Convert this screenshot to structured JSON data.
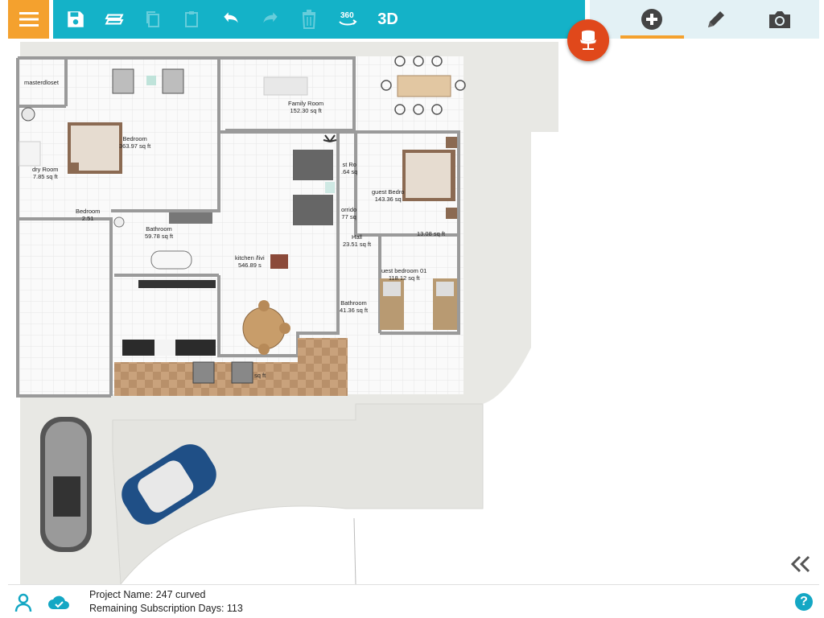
{
  "toolbar": {
    "menu_icon": "hamburger-icon",
    "buttons": [
      {
        "name": "save",
        "icon": "save-icon"
      },
      {
        "name": "layers",
        "icon": "layers-icon"
      },
      {
        "name": "copy",
        "icon": "copy-icon",
        "disabled": true
      },
      {
        "name": "paste",
        "icon": "paste-icon",
        "disabled": true
      },
      {
        "name": "undo",
        "icon": "undo-icon"
      },
      {
        "name": "redo",
        "icon": "redo-icon",
        "disabled": true
      },
      {
        "name": "delete",
        "icon": "trash-icon",
        "disabled": true
      }
    ],
    "view360_label": "360",
    "view3d_label": "3D"
  },
  "right_toolbar": {
    "tabs": [
      {
        "name": "add",
        "icon": "plus-circle-icon",
        "active": true
      },
      {
        "name": "edit",
        "icon": "pencil-icon"
      },
      {
        "name": "camera",
        "icon": "camera-icon"
      }
    ]
  },
  "fab": {
    "icon": "furniture-chair-icon"
  },
  "floorplan": {
    "rooms": [
      {
        "name": "masterdloset",
        "area": ""
      },
      {
        "name": "Bedroom",
        "area": "363.97 sq ft"
      },
      {
        "name": "Family Room",
        "area": "152.30 sq ft"
      },
      {
        "name": "dry Room",
        "area": "7.85 sq ft"
      },
      {
        "name": "Bathroom",
        "area": "59.78 sq ft"
      },
      {
        "name": "kitchen /livi",
        "area": "546.89 s"
      },
      {
        "name": "st Ro",
        "area": ".64 sq"
      },
      {
        "name": "guest Bedro",
        "area": "143.36 sq"
      },
      {
        "name": "orrido",
        "area": "77 sq"
      },
      {
        "name": "Hall",
        "area": "23.51 sq ft"
      },
      {
        "name": "",
        "area": "13.08 sq ft"
      },
      {
        "name": "uest bedroom 01",
        "area": "118.12 sq ft"
      },
      {
        "name": "Bathroom",
        "area": "41.36 sq ft"
      },
      {
        "name": "",
        "area": "sq ft"
      },
      {
        "name": "Bedroom",
        "area": "2.51"
      }
    ]
  },
  "bottom": {
    "project_name_label": "Project Name: 247 curved",
    "subscription_label": "Remaining Subscription Days: 113",
    "user_icon": "user-icon",
    "cloud_icon": "cloud-sync-icon",
    "help_label": "?",
    "collapse_icon": "double-chevron-left-icon"
  },
  "colors": {
    "toolbar": "#14b2c8",
    "menu": "#f4a12e",
    "fab": "#e0481b",
    "accent_line": "#f4a12e",
    "right_toolbar_bg": "#e3f1f5"
  }
}
